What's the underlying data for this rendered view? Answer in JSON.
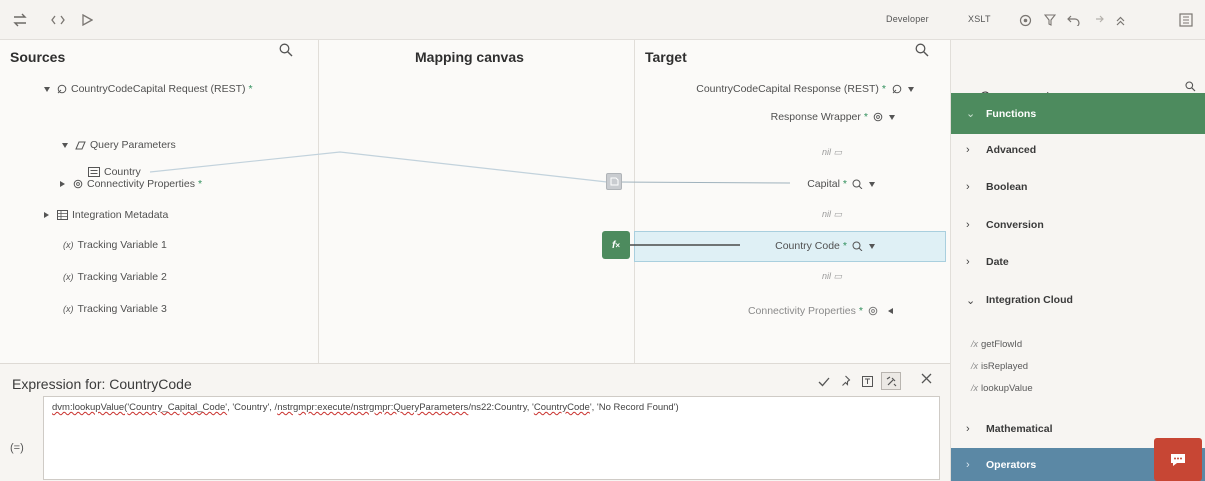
{
  "toolbar": {
    "left_icons": [
      "swap-icon",
      "code-icon",
      "play-icon"
    ],
    "mode_label": "Developer",
    "xslt_label": "XSLT",
    "right_icons": [
      "target-icon",
      "filter-icon",
      "undo-icon",
      "redo-icon",
      "collapse-icon",
      "panel-icon"
    ]
  },
  "sources": {
    "title": "Sources",
    "items": [
      {
        "label": "CountryCodeCapital Request (REST)",
        "star": "*"
      },
      {
        "label": "Query Parameters"
      },
      {
        "label": "Country"
      },
      {
        "label": "Connectivity Properties",
        "star": "*"
      },
      {
        "label": "Integration Metadata"
      },
      {
        "label": "Tracking Variable 1"
      },
      {
        "label": "Tracking Variable 2"
      },
      {
        "label": "Tracking Variable 3"
      }
    ]
  },
  "canvas": {
    "title": "Mapping canvas",
    "fx_label": "f"
  },
  "target": {
    "title": "Target",
    "items": [
      {
        "label": "CountryCodeCapital Response (REST)",
        "star": "*"
      },
      {
        "label": "Response Wrapper",
        "star": "*"
      },
      {
        "label": "nil"
      },
      {
        "label": "Capital",
        "star": "*"
      },
      {
        "label": "nil"
      },
      {
        "label": "Country Code",
        "star": "*"
      },
      {
        "label": "nil"
      },
      {
        "label": "Connectivity Properties",
        "star": "*"
      }
    ]
  },
  "expression": {
    "title": "Expression for: CountryCode",
    "side_label": "(=)",
    "text_parts": [
      "dvm:lookupValue(",
      "'Country_Capital_Code'",
      ", 'Country', /",
      "nstrgmpr:execute/nstrgmpr:QueryParameters",
      "/ns22:Country, '",
      "CountryCode",
      "', 'No Record Found')"
    ]
  },
  "components": {
    "title": "Components",
    "functions_label": "Functions",
    "categories": [
      "Advanced",
      "Boolean",
      "Conversion",
      "Date",
      "Integration Cloud",
      "Mathematical"
    ],
    "functions": [
      "getFlowId",
      "isReplayed",
      "lookupValue"
    ],
    "operators_label": "Operators"
  },
  "colors": {
    "accent_green": "#4d8b5e",
    "operators_blue": "#5b88a5",
    "chat_red": "#c74634",
    "highlight_row": "#dff0f5"
  }
}
